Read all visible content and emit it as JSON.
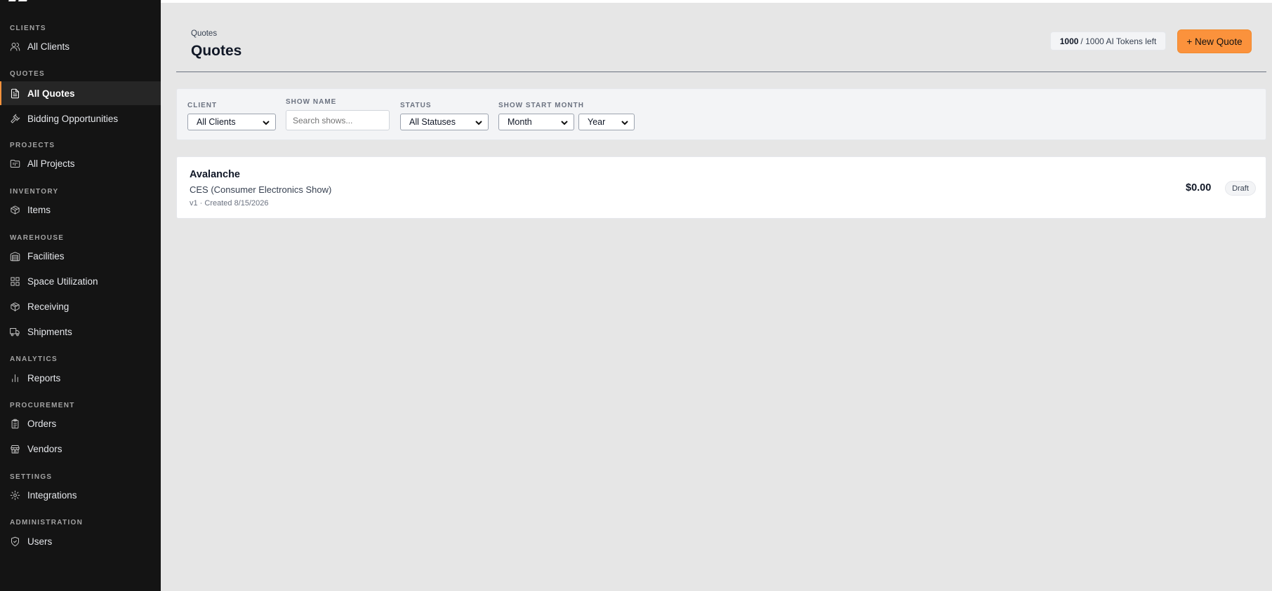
{
  "sidebar": {
    "sections": [
      {
        "label": "CLIENTS",
        "items": [
          {
            "label": "All Clients",
            "icon": "users-icon"
          }
        ]
      },
      {
        "label": "QUOTES",
        "items": [
          {
            "label": "All Quotes",
            "icon": "document-icon",
            "active": true
          },
          {
            "label": "Bidding Opportunities",
            "icon": "gavel-icon"
          }
        ]
      },
      {
        "label": "PROJECTS",
        "items": [
          {
            "label": "All Projects",
            "icon": "folder-kanban-icon"
          }
        ]
      },
      {
        "label": "INVENTORY",
        "items": [
          {
            "label": "Items",
            "icon": "package-icon"
          }
        ]
      },
      {
        "label": "WAREHOUSE",
        "items": [
          {
            "label": "Facilities",
            "icon": "warehouse-icon"
          },
          {
            "label": "Space Utilization",
            "icon": "grid-icon"
          },
          {
            "label": "Receiving",
            "icon": "package-open-icon"
          },
          {
            "label": "Shipments",
            "icon": "truck-icon"
          }
        ]
      },
      {
        "label": "ANALYTICS",
        "items": [
          {
            "label": "Reports",
            "icon": "bar-chart-icon"
          }
        ]
      },
      {
        "label": "PROCUREMENT",
        "items": [
          {
            "label": "Orders",
            "icon": "clipboard-icon"
          },
          {
            "label": "Vendors",
            "icon": "store-icon"
          }
        ]
      },
      {
        "label": "SETTINGS",
        "items": [
          {
            "label": "Integrations",
            "icon": "gear-icon"
          }
        ]
      },
      {
        "label": "ADMINISTRATION",
        "items": [
          {
            "label": "Users",
            "icon": "shield-check-icon"
          }
        ]
      }
    ]
  },
  "header": {
    "breadcrumb": "Quotes",
    "title": "Quotes",
    "tokens_used": "1000",
    "tokens_rest": "/ 1000 AI Tokens left",
    "new_quote_label": "+ New Quote"
  },
  "filters": {
    "client_label": "CLIENT",
    "client_value": "All Clients",
    "show_name_label": "SHOW NAME",
    "show_name_placeholder": "Search shows...",
    "status_label": "STATUS",
    "status_value": "All Statuses",
    "month_label": "SHOW START MONTH",
    "month_value": "Month",
    "year_value": "Year"
  },
  "quotes": [
    {
      "name": "Avalanche",
      "show": "CES (Consumer Electronics Show)",
      "meta": "v1 · Created 8/15/2026",
      "amount": "$0.00",
      "status": "Draft"
    }
  ],
  "colors": {
    "accent": "#fb923c",
    "sidebar_bg": "#141414",
    "page_bg": "#e6e6e6"
  }
}
